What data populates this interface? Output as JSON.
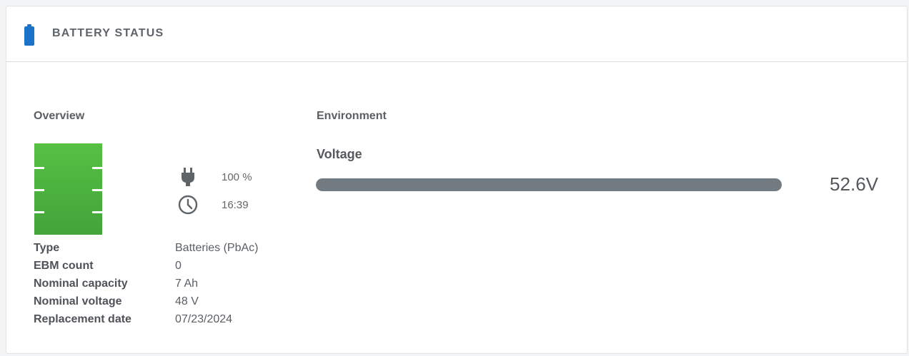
{
  "header": {
    "title": "BATTERY STATUS",
    "icon": "battery-icon",
    "accent_color": "#1a73c9"
  },
  "overview": {
    "title": "Overview",
    "battery_color": "#4cb83e",
    "charge": {
      "icon": "plug-icon",
      "value": "100 %"
    },
    "runtime": {
      "icon": "clock-icon",
      "value": "16:39"
    },
    "details": [
      {
        "label": "Type",
        "value": "Batteries (PbAc)"
      },
      {
        "label": "EBM count",
        "value": "0"
      },
      {
        "label": "Nominal capacity",
        "value": "7 Ah"
      },
      {
        "label": "Nominal voltage",
        "value": "48 V"
      },
      {
        "label": "Replacement date",
        "value": "07/23/2024"
      }
    ]
  },
  "environment": {
    "title": "Environment",
    "voltage": {
      "label": "Voltage",
      "value": "52.6V",
      "fill_fraction": 1.0,
      "bar_color": "#737b82"
    }
  }
}
